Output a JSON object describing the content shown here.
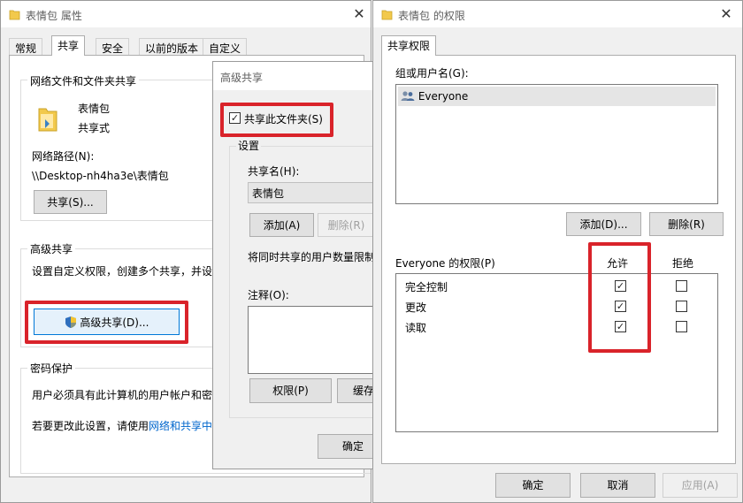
{
  "props_window": {
    "title": "表情包 属性",
    "tabs": [
      "常规",
      "共享",
      "安全",
      "以前的版本",
      "自定义"
    ],
    "net_share_group": "网络文件和文件夹共享",
    "folder_name": "表情包",
    "share_status": "共享式",
    "net_path_label": "网络路径(N):",
    "net_path_value": "\\\\Desktop-nh4ha3e\\表情包",
    "share_button": "共享(S)...",
    "adv_group": "高级共享",
    "adv_desc": "设置自定义权限，创建多个共享，并设",
    "adv_button": "高级共享(D)...",
    "pwd_group": "密码保护",
    "pwd_desc": "用户必须具有此计算机的用户帐户和密",
    "pwd_change": "若要更改此设置，请使用",
    "pwd_link": "网络和共享中"
  },
  "adv_window": {
    "title": "高级共享",
    "share_checkbox": "共享此文件夹(S)",
    "settings_group": "设置",
    "share_name_label": "共享名(H):",
    "share_name_value": "表情包",
    "add_button": "添加(A)",
    "remove_button": "删除(R)",
    "limit_text": "将同时共享的用户数量限制",
    "comment_label": "注释(O):",
    "permissions_button": "权限(P)",
    "cache_button": "缓存",
    "ok_button": "确定"
  },
  "perm_window": {
    "title": "表情包 的权限",
    "tab": "共享权限",
    "group_label": "组或用户名(G):",
    "users": [
      "Everyone"
    ],
    "add_button": "添加(D)...",
    "remove_button": "删除(R)",
    "perm_label": "Everyone 的权限(P)",
    "allow_header": "允许",
    "deny_header": "拒绝",
    "permissions": [
      {
        "name": "完全控制",
        "allow": true,
        "deny": false
      },
      {
        "name": "更改",
        "allow": true,
        "deny": false
      },
      {
        "name": "读取",
        "allow": true,
        "deny": false
      }
    ],
    "ok_button": "确定",
    "cancel_button": "取消",
    "apply_button": "应用(A)"
  },
  "colors": {
    "highlight_red": "#d9232a",
    "link_blue": "#0066cc",
    "folder_yellow": "#f2c94c"
  }
}
